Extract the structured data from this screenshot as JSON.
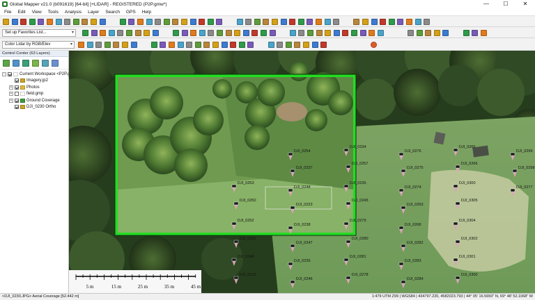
{
  "app": {
    "title": "Global Mapper v21.0 (b091619) [64-bit] [+LIDAR] - REGISTERED (P2P.gmw*)",
    "window_controls": [
      "—",
      "☐",
      "✕"
    ]
  },
  "menu": [
    "File",
    "Edit",
    "View",
    "Tools",
    "Analysis",
    "Layer",
    "Search",
    "GPS",
    "Help"
  ],
  "toolbars": {
    "favorites": "Set up Favorites List...",
    "lidar_color": "Color Lidar by RGB/Elev"
  },
  "control_center": {
    "title": "Control Center (63 Layers)",
    "layers": [
      {
        "label": "Current Workspace <P2P.g",
        "indent": 0,
        "expand": "−",
        "checked": true,
        "color": "#ffffff"
      },
      {
        "label": "Imagery.jp2",
        "indent": 1,
        "expand": "",
        "checked": true,
        "color": "#c9a227"
      },
      {
        "label": "Photos",
        "indent": 1,
        "expand": "+",
        "checked": true,
        "color": "#e0b83a"
      },
      {
        "label": "field.gmp",
        "indent": 1,
        "expand": "+",
        "checked": false,
        "color": "#ffffff"
      },
      {
        "label": "Ground Coverage",
        "indent": 1,
        "expand": "+",
        "checked": true,
        "color": "#3c9c3c"
      },
      {
        "label": "DJI_0230 Ortho",
        "indent": 1,
        "expand": "",
        "checked": true,
        "color": "#c9a227"
      }
    ]
  },
  "map": {
    "scale_labels": [
      "5 m",
      "15 m",
      "25 m",
      "35 m",
      "45 m"
    ],
    "highlight_color": "#22dd22",
    "photo_labels": [
      "DJI_0253",
      "DJI_0250",
      "DJI_0252",
      "DJI_0251",
      "DJI_0249",
      "DJI_0213",
      "DJI_0254",
      "DJI_0237",
      "DJI_0248",
      "DJI_0223",
      "DJI_0238",
      "DJI_0247",
      "DJI_0236",
      "DJI_0246",
      "DJI_0234",
      "DJI_0257",
      "DJI_0235",
      "DJI_0245",
      "DJI_0279",
      "DJI_0280",
      "DJI_0281",
      "DJI_0278",
      "DJI_0276",
      "DJI_0275",
      "DJI_0274",
      "DJI_0263",
      "DJI_0268",
      "DJI_0282",
      "DJI_0283",
      "DJI_0284",
      "DJI_0265",
      "DJI_0266",
      "DJI_0300",
      "DJI_0305",
      "DJI_0304",
      "DJI_0302",
      "DJI_0301",
      "DJI_0300",
      "DJI_0299",
      "DJI_0298",
      "DJI_0277"
    ]
  },
  "status": {
    "left": "<DJI_0230.JPG> Aerial Coverage [52.442 m]",
    "right": "1:479  UTM Z99 | WGS84 | 434797.220, 4582023.793 | 44° 05' 16.5650\" N, 69° 48' 52.1068\" W"
  }
}
